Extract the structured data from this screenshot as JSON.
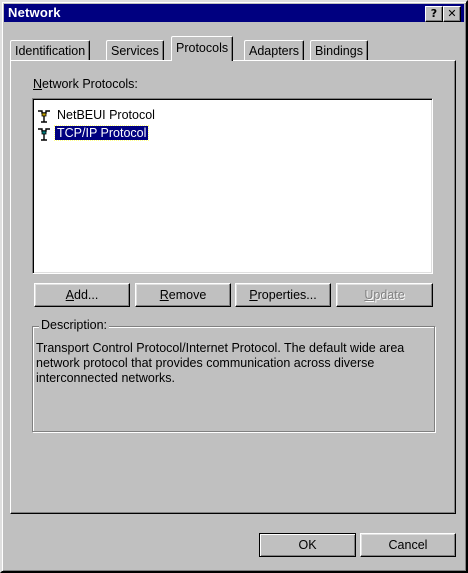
{
  "window": {
    "title": "Network",
    "help_label": "?",
    "close_label": "✕"
  },
  "tabs": [
    {
      "label": "Identification",
      "active": false
    },
    {
      "label": "Services",
      "active": false
    },
    {
      "label": "Protocols",
      "active": true
    },
    {
      "label": "Adapters",
      "active": false
    },
    {
      "label": "Bindings",
      "active": false
    }
  ],
  "protocols": {
    "label_first": "N",
    "label_rest": "etwork Protocols:",
    "items": [
      {
        "label": "NetBEUI Protocol",
        "icon": "network-protocol-icon",
        "selected": false
      },
      {
        "label": "TCP/IP Protocol",
        "icon": "network-protocol-icon",
        "selected": true
      }
    ]
  },
  "buttons": {
    "add_u": "A",
    "add_rest": "dd...",
    "remove_u": "R",
    "remove_rest": "emove",
    "properties_u": "P",
    "properties_rest": "roperties...",
    "update_u": "U",
    "update_rest": "pdate",
    "ok": "OK",
    "cancel": "Cancel"
  },
  "description": {
    "legend": "Description:",
    "text": "Transport Control Protocol/Internet Protocol. The default wide area network protocol that provides communication across diverse interconnected networks."
  },
  "colors": {
    "titlebar": "#000080",
    "face": "#c0c0c0",
    "selection": "#000080"
  }
}
